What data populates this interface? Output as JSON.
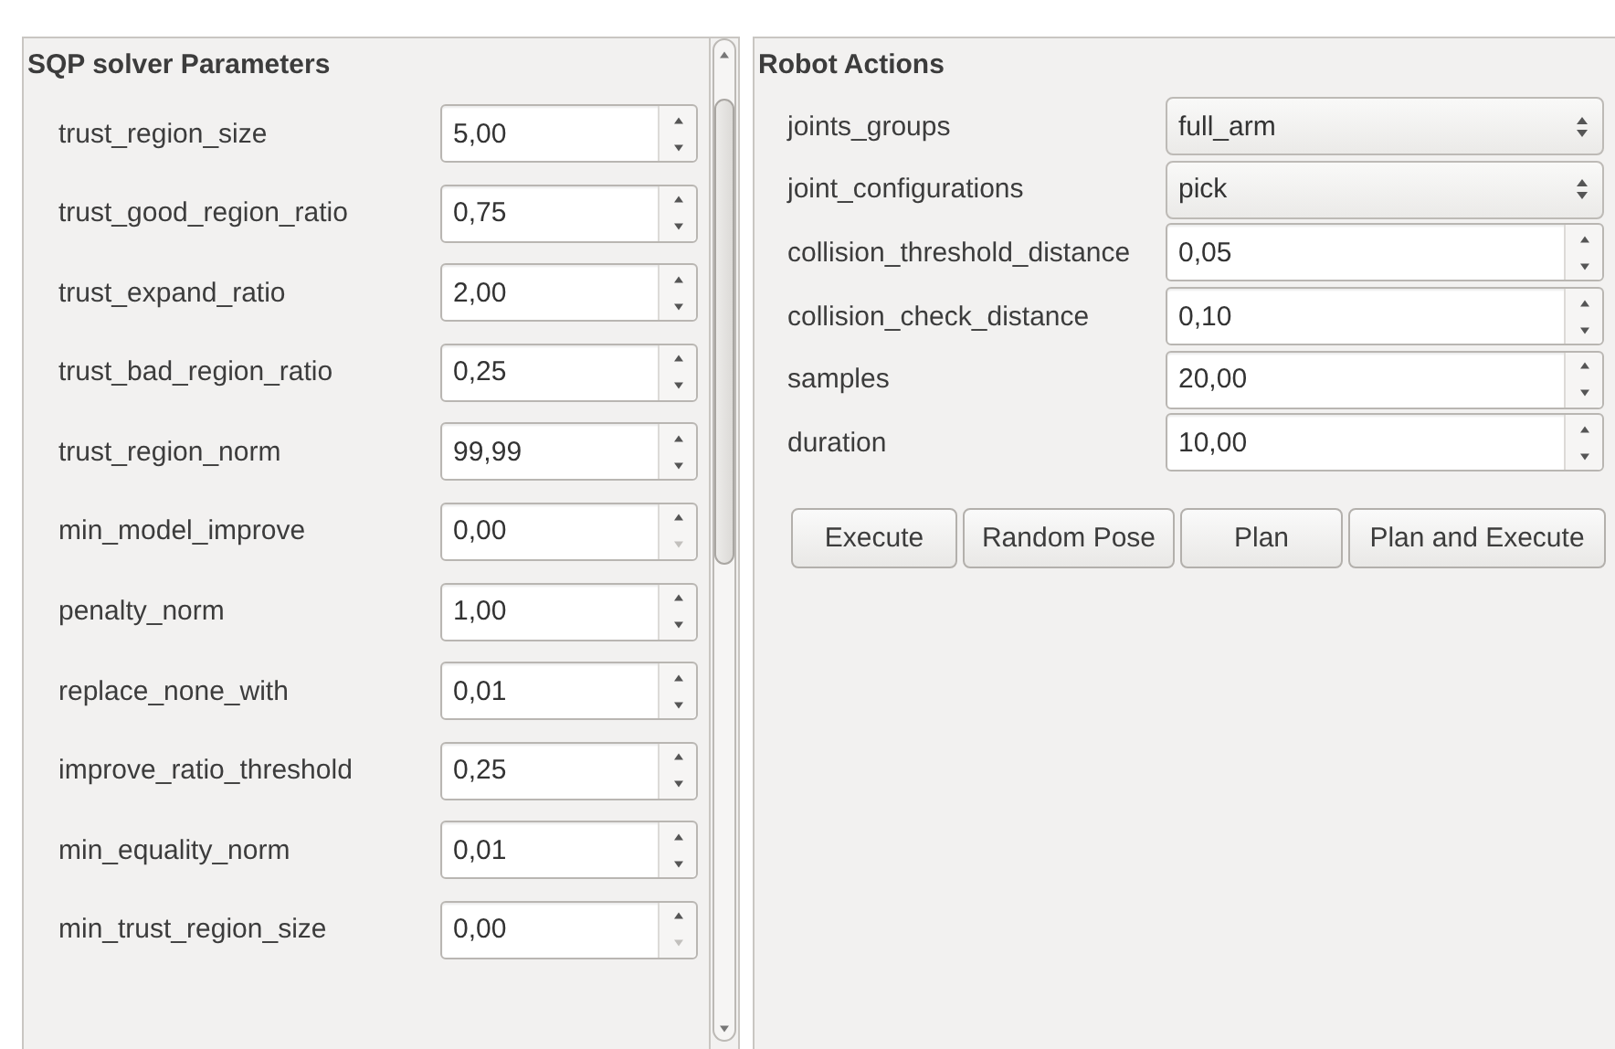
{
  "solver_panel": {
    "title": "SQP solver Parameters",
    "rows": [
      {
        "label": "trust_region_size",
        "value": "5,00",
        "down_disabled": false
      },
      {
        "label": "trust_good_region_ratio",
        "value": "0,75",
        "down_disabled": false
      },
      {
        "label": "trust_expand_ratio",
        "value": "2,00",
        "down_disabled": false
      },
      {
        "label": "trust_bad_region_ratio",
        "value": "0,25",
        "down_disabled": false
      },
      {
        "label": "trust_region_norm",
        "value": "99,99",
        "down_disabled": false
      },
      {
        "label": "min_model_improve",
        "value": "0,00",
        "down_disabled": true
      },
      {
        "label": "penalty_norm",
        "value": "1,00",
        "down_disabled": false
      },
      {
        "label": "replace_none_with",
        "value": "0,01",
        "down_disabled": false
      },
      {
        "label": "improve_ratio_threshold",
        "value": "0,25",
        "down_disabled": false
      },
      {
        "label": "min_equality_norm",
        "value": "0,01",
        "down_disabled": false
      },
      {
        "label": "min_trust_region_size",
        "value": "0,00",
        "down_disabled": true
      }
    ]
  },
  "actions_panel": {
    "title": "Robot Actions",
    "fields": [
      {
        "label": "joints_groups",
        "kind": "combo",
        "value": "full_arm"
      },
      {
        "label": "joint_configurations",
        "kind": "combo",
        "value": "pick"
      },
      {
        "label": "collision_threshold_distance",
        "kind": "spin",
        "value": "0,05"
      },
      {
        "label": "collision_check_distance",
        "kind": "spin",
        "value": "0,10"
      },
      {
        "label": "samples",
        "kind": "spin",
        "value": "20,00"
      },
      {
        "label": "duration",
        "kind": "spin",
        "value": "10,00"
      }
    ],
    "buttons": [
      "Execute",
      "Random Pose",
      "Plan",
      "Plan and Execute"
    ]
  }
}
